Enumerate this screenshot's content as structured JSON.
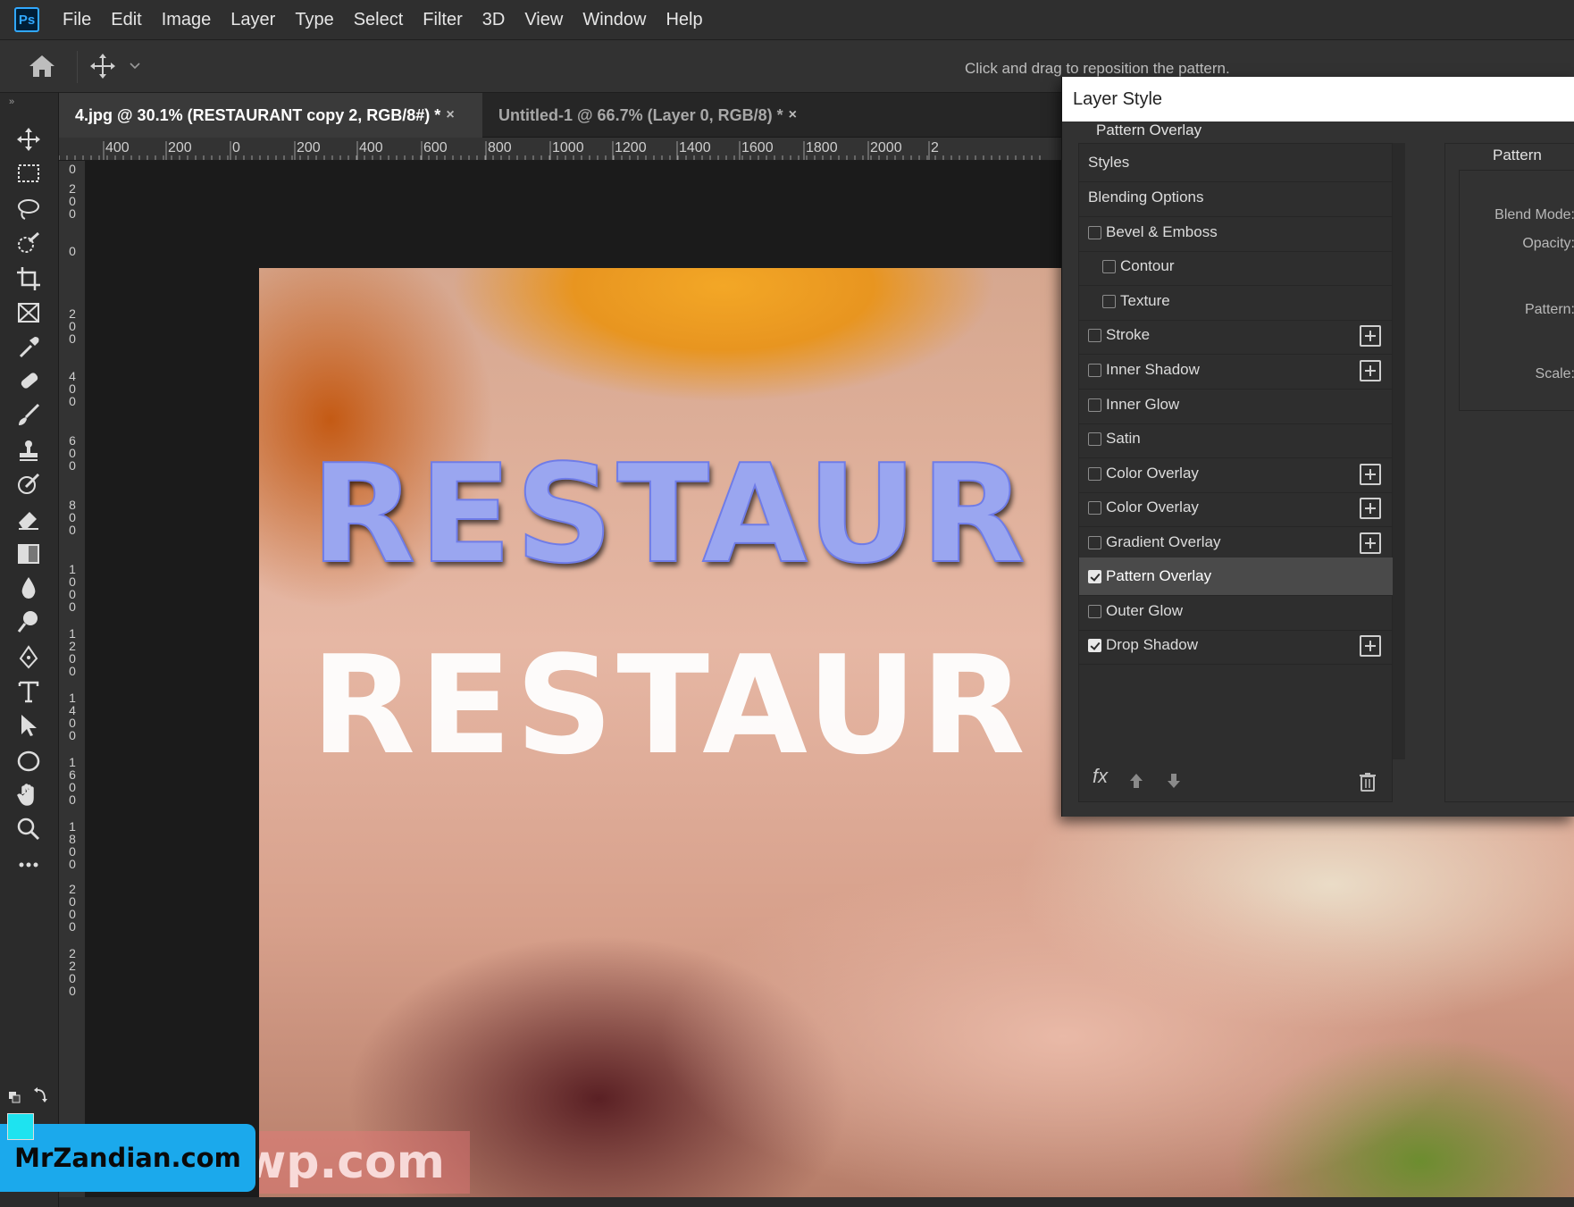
{
  "app": {
    "logo": "Ps",
    "menu": [
      "File",
      "Edit",
      "Image",
      "Layer",
      "Type",
      "Select",
      "Filter",
      "3D",
      "View",
      "Window",
      "Help"
    ]
  },
  "options_bar": {
    "hint": "Click and drag to reposition the pattern.",
    "icons": [
      "home-icon",
      "move-icon",
      "chevron-down-icon"
    ]
  },
  "tabs": [
    {
      "label": "4.jpg @ 30.1% (RESTAURANT copy 2, RGB/8#) *",
      "close": "×",
      "active": true
    },
    {
      "label": "Untitled-1 @ 66.7% (Layer 0, RGB/8) *",
      "close": "×",
      "active": false
    }
  ],
  "ruler": {
    "horizontal": [
      "400",
      "200",
      "0",
      "200",
      "400",
      "600",
      "800",
      "1000",
      "1200",
      "1400",
      "1600",
      "1800",
      "2000",
      "2"
    ],
    "vertical": [
      "0",
      "200",
      "0",
      "200",
      "400",
      "600",
      "800",
      "1000",
      "1200",
      "1400",
      "1600",
      "1800",
      "2000",
      "2200"
    ]
  },
  "toolbar": {
    "collapse": "»",
    "tools": [
      "move-tool-icon",
      "marquee-tool-icon",
      "lasso-tool-icon",
      "quick-select-tool-icon",
      "crop-tool-icon",
      "frame-tool-icon",
      "eyedropper-tool-icon",
      "healing-brush-tool-icon",
      "brush-tool-icon",
      "clone-stamp-tool-icon",
      "history-brush-tool-icon",
      "eraser-tool-icon",
      "gradient-tool-icon",
      "blur-tool-icon",
      "dodge-tool-icon",
      "pen-tool-icon",
      "type-tool-icon",
      "path-selection-tool-icon",
      "ellipse-tool-icon",
      "hand-tool-icon",
      "zoom-tool-icon",
      "more-tools-icon"
    ],
    "foreground_color": "#1ee3f0",
    "background_color": "#000000"
  },
  "canvas": {
    "text_pattern": "RESTAUR",
    "text_white": "RESTAUR",
    "faint_watermark": "rwp.com"
  },
  "layer_style": {
    "title": "Layer Style",
    "items": [
      {
        "label": "Styles",
        "checkbox": false,
        "checked": false,
        "plus": false,
        "indent": 0,
        "active": false
      },
      {
        "label": "Blending Options",
        "checkbox": false,
        "checked": false,
        "plus": false,
        "indent": 0,
        "active": false
      },
      {
        "label": "Bevel & Emboss",
        "checkbox": true,
        "checked": false,
        "plus": false,
        "indent": 0,
        "active": false
      },
      {
        "label": "Contour",
        "checkbox": true,
        "checked": false,
        "plus": false,
        "indent": 1,
        "active": false
      },
      {
        "label": "Texture",
        "checkbox": true,
        "checked": false,
        "plus": false,
        "indent": 1,
        "active": false
      },
      {
        "label": "Stroke",
        "checkbox": true,
        "checked": false,
        "plus": true,
        "indent": 0,
        "active": false
      },
      {
        "label": "Inner Shadow",
        "checkbox": true,
        "checked": false,
        "plus": true,
        "indent": 0,
        "active": false
      },
      {
        "label": "Inner Glow",
        "checkbox": true,
        "checked": false,
        "plus": false,
        "indent": 0,
        "active": false
      },
      {
        "label": "Satin",
        "checkbox": true,
        "checked": false,
        "plus": false,
        "indent": 0,
        "active": false
      },
      {
        "label": "Color Overlay",
        "checkbox": true,
        "checked": false,
        "plus": true,
        "indent": 0,
        "active": false
      },
      {
        "label": "Color Overlay",
        "checkbox": true,
        "checked": false,
        "plus": true,
        "indent": 0,
        "active": false
      },
      {
        "label": "Gradient Overlay",
        "checkbox": true,
        "checked": false,
        "plus": true,
        "indent": 0,
        "active": false
      },
      {
        "label": "Pattern Overlay",
        "checkbox": true,
        "checked": true,
        "plus": false,
        "indent": 0,
        "active": true
      },
      {
        "label": "Outer Glow",
        "checkbox": true,
        "checked": false,
        "plus": false,
        "indent": 0,
        "active": false
      },
      {
        "label": "Drop Shadow",
        "checkbox": true,
        "checked": true,
        "plus": true,
        "indent": 0,
        "active": false
      }
    ],
    "footer": {
      "fx": "fx",
      "icons": [
        "move-up-icon",
        "move-down-icon",
        "trash-icon"
      ]
    },
    "panel": {
      "title": "Pattern Overlay",
      "group": "Pattern",
      "blend_mode_label": "Blend Mode:",
      "opacity_label": "Opacity:",
      "pattern_label": "Pattern:",
      "scale_label": "Scale:"
    }
  },
  "brand": {
    "text": "MrZandian.com"
  }
}
